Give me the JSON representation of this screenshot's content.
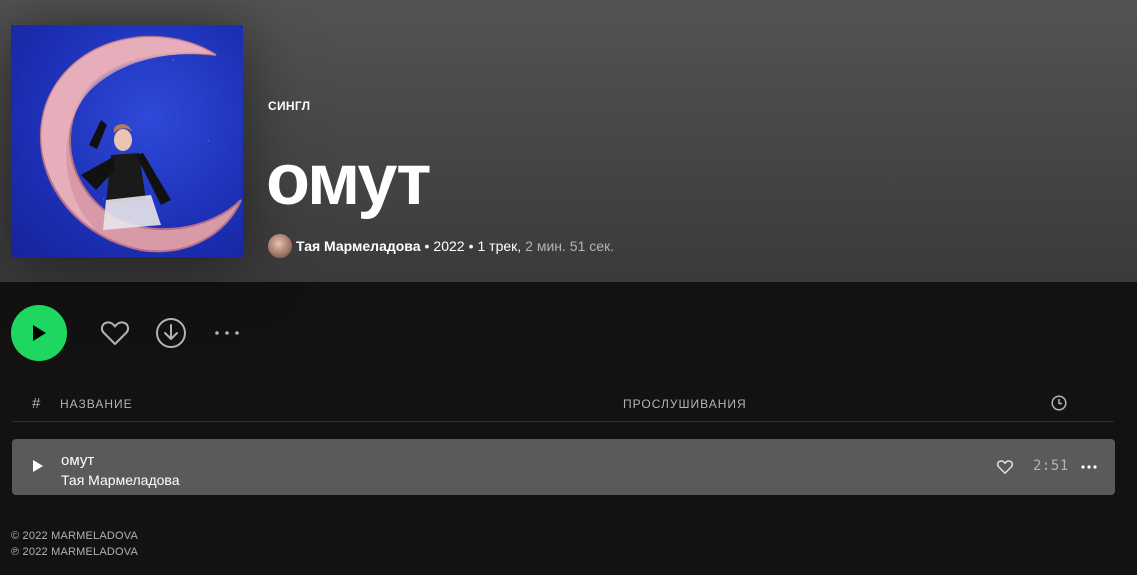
{
  "album": {
    "type_label": "СИНГЛ",
    "title": "омут",
    "artist": "Тая Мармеладова",
    "year": "2022",
    "track_count": "1 трек,",
    "duration": "2 мин. 51 сек."
  },
  "actions": {
    "play_icon": "play-icon",
    "like_icon": "heart-icon",
    "download_icon": "download-icon",
    "more_icon": "more-icon"
  },
  "table": {
    "col_num": "#",
    "col_title": "НАЗВАНИЕ",
    "col_plays": "ПРОСЛУШИВАНИЯ",
    "col_duration_icon": "clock-icon"
  },
  "tracks": [
    {
      "name": "омут",
      "artist": "Тая Мармеладова",
      "plays": "",
      "duration": "2:51"
    }
  ],
  "copyright": {
    "c": "© 2022 MARMELADOVA",
    "p": "℗ 2022 MARMELADOVA"
  },
  "colors": {
    "accent": "#1ed760",
    "background": "#121212",
    "row_highlight": "#5a5a5a",
    "muted_text": "#b3b3b3"
  }
}
